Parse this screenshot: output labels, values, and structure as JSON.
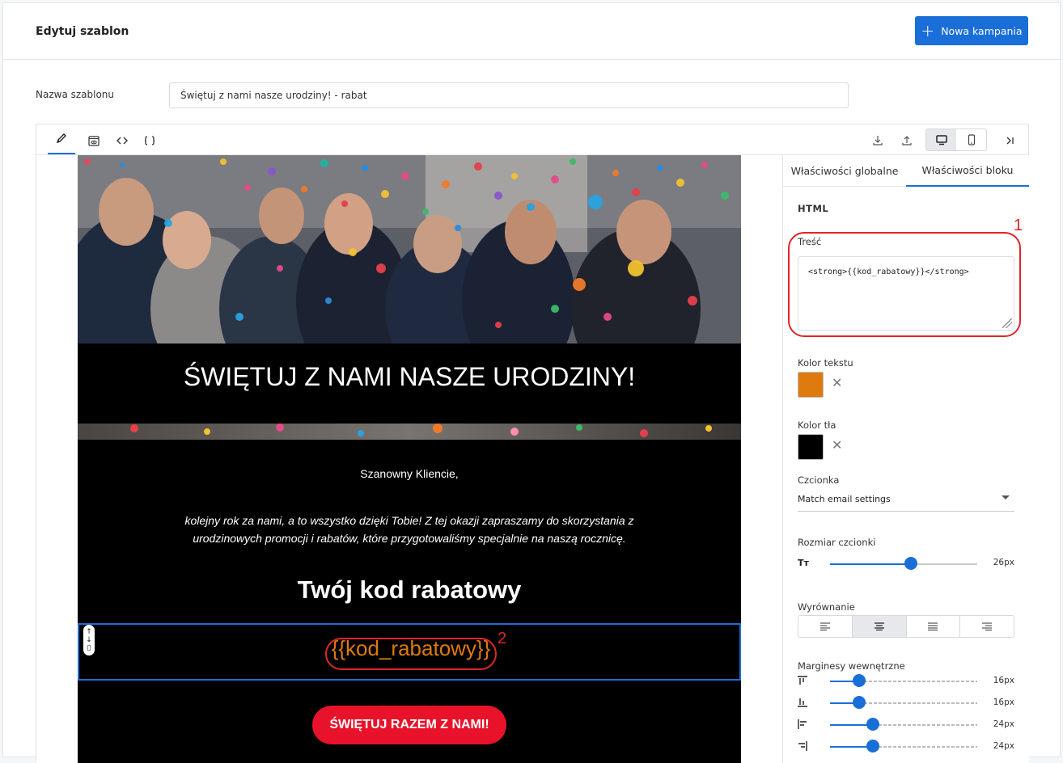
{
  "header": {
    "title": "Edytuj szablon",
    "new_campaign_label": "Nowa kampania"
  },
  "template_name": {
    "label": "Nazwa szablonu",
    "value": "Świętuj z nami nasze urodziny! - rabat"
  },
  "toolbar": {
    "left_icons": [
      "pencil-icon",
      "eye-icon",
      "code-icon",
      "braces-icon"
    ],
    "right_icons": [
      "download-icon",
      "upload-icon",
      "desktop-icon",
      "mobile-icon",
      "collapse-panel-icon"
    ],
    "active_view": "desktop"
  },
  "email": {
    "headline": "ŚWIĘTUJ Z NAMI NASZE URODZINY!",
    "greeting": "Szanowny Kliencie,",
    "body": "kolejny rok za nami, a to wszystko dzięki Tobie! Z tej okazji zapraszamy do skorzystania z urodzinowych promocji i rabatów, które przygotowaliśmy specjalnie na naszą rocznicę.",
    "code_title": "Twój kod rabatowy",
    "code_value": "{{kod_rabatowy}}",
    "cta_label": "ŚWIĘTUJ RAZEM Z NAMI!",
    "annotation_marker": "2",
    "colors": {
      "background": "#000000",
      "code": "#de7a0e",
      "cta": "#e8132a"
    }
  },
  "panel": {
    "tabs": [
      "Właściwości globalne",
      "Właściwości bloku"
    ],
    "active_tab": 1,
    "section_title": "HTML",
    "content_label": "Treść",
    "content_value": "<strong>{{kod_rabatowy}}</strong>",
    "annotation_marker": "1",
    "text_color_label": "Kolor tekstu",
    "text_color": "#de7a0e",
    "bg_color_label": "Kolor tła",
    "bg_color": "#000000",
    "font_label": "Czcionka",
    "font_value": "Match email settings",
    "font_size_label": "Rozmiar czcionki",
    "font_size_value": "26px",
    "font_size_fraction": 0.55,
    "alignment_label": "Wyrównanie",
    "alignment_options": [
      "align-left-icon",
      "align-center-icon",
      "align-justify-icon",
      "align-right-icon"
    ],
    "alignment_selected": "center",
    "padding_label": "Marginesy wewnętrzne",
    "padding": [
      {
        "side": "top",
        "value": "16px",
        "fraction": 0.2
      },
      {
        "side": "bottom",
        "value": "16px",
        "fraction": 0.2
      },
      {
        "side": "left",
        "value": "24px",
        "fraction": 0.29
      },
      {
        "side": "right",
        "value": "24px",
        "fraction": 0.29
      }
    ]
  }
}
